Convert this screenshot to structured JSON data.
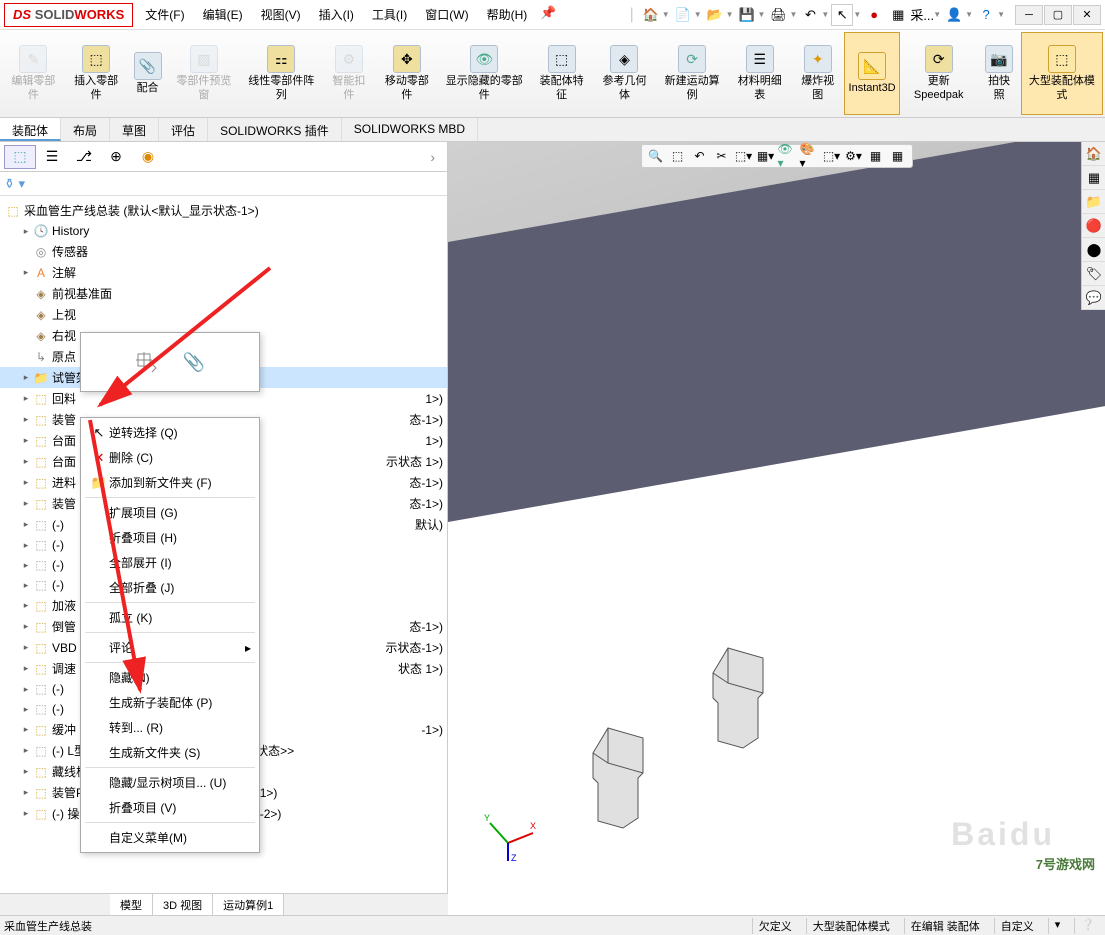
{
  "app": {
    "name": "SOLIDWORKS"
  },
  "menu": {
    "file": "文件(F)",
    "edit": "编辑(E)",
    "view": "视图(V)",
    "insert": "插入(I)",
    "tools": "工具(I)",
    "window": "窗口(W)",
    "help": "帮助(H)"
  },
  "titlebar_right": {
    "search": "采..."
  },
  "ribbon": {
    "edit_part": "编辑零部件",
    "insert_part": "插入零部件",
    "mate": "配合",
    "preview": "零部件预览窗",
    "linear_pattern": "线性零部件阵列",
    "smart_fastener": "智能扣件",
    "move_part": "移动零部件",
    "show_hidden": "显示隐藏的零部件",
    "assembly_feature": "装配体特征",
    "ref_geometry": "参考几何体",
    "new_motion": "新建运动算例",
    "bom": "材料明细表",
    "exploded": "爆炸视图",
    "instant3d": "Instant3D",
    "update_speedpak": "更新Speedpak",
    "snapshot": "拍快照",
    "large_assembly": "大型装配体模式"
  },
  "tabs": {
    "assembly": "装配体",
    "layout": "布局",
    "sketch": "草图",
    "evaluate": "评估",
    "sw_plugin": "SOLIDWORKS 插件",
    "sw_mbd": "SOLIDWORKS MBD"
  },
  "tree": {
    "root": "采血管生产线总装 (默认<默认_显示状态-1>)",
    "history": "History",
    "sensor": "传感器",
    "annotation": "注解",
    "front": "前视基准面",
    "top": "上视",
    "right": "右视",
    "origin": "原点",
    "selected": "试管架",
    "items": [
      "回料",
      "装管",
      "台面",
      "台面",
      "进料",
      "装管"
    ],
    "item_suffixes": [
      "1>)",
      "态-1>)",
      "1>)",
      "示状态 1>)",
      "态-1>)",
      "态-1>)"
    ],
    "suppressed": [
      "(-)",
      "(-)",
      "(-)",
      "(-)"
    ],
    "suppressed_suffix": [
      "默认)",
      "",
      "",
      ""
    ],
    "more1": "加液",
    "more2": "倒管",
    "more2_suffix": "态-1>)",
    "more3": "VBD",
    "more3_suffix": "示状态-1>)",
    "more4": "调速",
    "more4_suffix": "状态 1>)",
    "more5": "(-)",
    "more6": "(-)",
    "more7": "缓冲",
    "more7_suffix": "-1>)",
    "more8": "(-) L型任开成品400新款马达ITO <显示状态>>",
    "more9": "藏线板<1> (默认<<默认>_显示状态 1>)",
    "more10": "装管PC板<1> (默认<<默认>_显示状态 1>)",
    "more11": "(-) 操作组件2<1> (第2种形式<显示状态-2>)"
  },
  "context_menu": {
    "invert": "逆转选择 (Q)",
    "delete": "删除 (C)",
    "add_folder": "添加到新文件夹 (F)",
    "expand": "扩展项目 (G)",
    "collapse": "折叠项目 (H)",
    "expand_all": "全部展开 (I)",
    "collapse_all": "全部折叠 (J)",
    "isolate": "孤立 (K)",
    "comment": "评论",
    "hide": "隐藏(N)",
    "new_subassembly": "生成新子装配体 (P)",
    "goto": "转到... (R)",
    "new_folder": "生成新文件夹 (S)",
    "hide_show_tree": "隐藏/显示树项目... (U)",
    "collapse_item": "折叠项目 (V)",
    "customize": "自定义菜单(M)"
  },
  "bottom_tabs": {
    "model": "模型",
    "view3d": "3D 视图",
    "motion": "运动算例1"
  },
  "statusbar": {
    "left": "采血管生产线总装",
    "undefined": "欠定义",
    "large_mode": "大型装配体模式",
    "editing": "在编辑 装配体",
    "custom": "自定义"
  },
  "watermark": "Baidu",
  "watermark2": "7号游戏网"
}
